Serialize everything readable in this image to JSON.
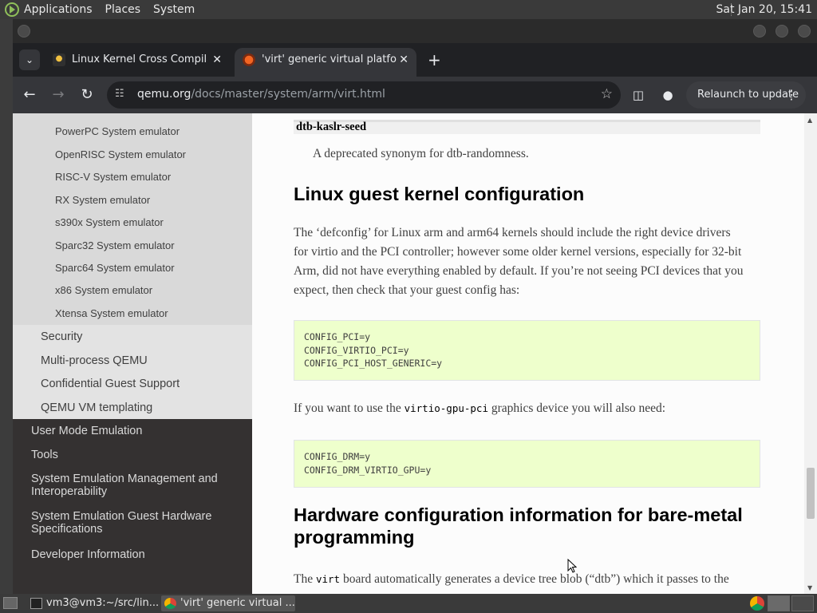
{
  "top_panel": {
    "menus": [
      "Applications",
      "Places",
      "System"
    ],
    "clock": "Sat Jan 20, 15:41"
  },
  "tabs": [
    {
      "label": "Linux Kernel Cross Compilation",
      "active": false
    },
    {
      "label": "'virt' generic virtual platform",
      "active": true
    }
  ],
  "tab_close": "✕",
  "new_tab": "+",
  "toolbar": {
    "url_host": "qemu.org",
    "url_path": "/docs/master/system/arm/virt.html",
    "relaunch_label": "Relaunch to update"
  },
  "sidebar": {
    "level3_items": [
      "PowerPC System emulator",
      "OpenRISC System emulator",
      "RISC-V System emulator",
      "RX System emulator",
      "s390x System emulator",
      "Sparc32 System emulator",
      "Sparc64 System emulator",
      "x86 System emulator",
      "Xtensa System emulator"
    ],
    "level2_items": [
      "Security",
      "Multi-process QEMU",
      "Confidential Guest Support",
      "QEMU VM templating"
    ],
    "level1_items": [
      {
        "lines": [
          "User Mode Emulation"
        ]
      },
      {
        "lines": [
          "Tools"
        ]
      },
      {
        "lines": [
          "System Emulation Management and",
          "Interoperability"
        ]
      },
      {
        "lines": [
          "System Emulation Guest Hardware",
          "Specifications"
        ]
      },
      {
        "lines": [
          "Developer Information"
        ]
      }
    ]
  },
  "doc": {
    "dt_term": "dtb-kaslr-seed",
    "dt_desc": "A deprecated synonym for dtb-randomness.",
    "heading1": "Linux guest kernel configuration",
    "para1_lines": [
      "The ‘defconfig’ for Linux arm and arm64 kernels should include the right device drivers",
      "for virtio and the PCI controller; however some older kernel versions, especially for 32-bit",
      "Arm, did not have everything enabled by default. If you’re not seeing PCI devices that you",
      "expect, then check that your guest config has:"
    ],
    "code1": "CONFIG_PCI=y\nCONFIG_VIRTIO_PCI=y\nCONFIG_PCI_HOST_GENERIC=y",
    "para2_pre": "If you want to use the ",
    "para2_code": "virtio-gpu-pci",
    "para2_post": " graphics device you will also need:",
    "code2": "CONFIG_DRM=y\nCONFIG_DRM_VIRTIO_GPU=y",
    "heading2_lines": [
      "Hardware configuration information for bare-metal",
      "programming"
    ],
    "para3_pre": "The ",
    "para3_code": "virt",
    "para3_post": " board automatically generates a device tree blob (“dtb”) which it passes to the"
  },
  "taskbar": [
    {
      "label": "vm3@vm3:~/src/lin..."
    },
    {
      "label": "'virt' generic virtual ..."
    }
  ],
  "colors": {
    "sidebar_dark": "#343131",
    "code_bg": "#eeffcc",
    "browser_toolbar": "#35363a"
  }
}
